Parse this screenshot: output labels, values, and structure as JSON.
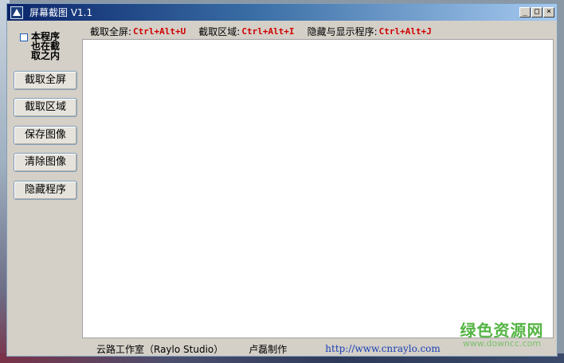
{
  "window": {
    "title": "屏幕截图 V1.1",
    "controls": {
      "minimize": "_",
      "maximize": "□",
      "close": "×"
    }
  },
  "sidebar": {
    "checkbox_label": "本程序也在截取之内",
    "checkbox_checked": false,
    "buttons": [
      {
        "label": "截取全屏"
      },
      {
        "label": "截取区域"
      },
      {
        "label": "保存图像"
      },
      {
        "label": "清除图像"
      },
      {
        "label": "隐藏程序"
      }
    ]
  },
  "hotkeys": [
    {
      "label": "截取全屏:",
      "key": "Ctrl+Alt+U"
    },
    {
      "label": "截取区域:",
      "key": "Ctrl+Alt+I"
    },
    {
      "label": "隐藏与显示程序:",
      "key": "Ctrl+Alt+J"
    }
  ],
  "footer": {
    "studio": "云路工作室（Raylo Studio）",
    "author": "卢磊制作",
    "url": "http://www.cnraylo.com"
  },
  "watermark": {
    "main": "绿色资源网",
    "sub": "www.downcc.com"
  },
  "colors": {
    "hotkey": "#d00000",
    "url": "#1a3fb3",
    "watermark": "#54b444",
    "title_bar_start": "#0a246a"
  },
  "icons": {
    "app": "app-logo-icon",
    "minimize": "minimize-icon",
    "maximize": "maximize-icon",
    "close": "close-icon"
  }
}
